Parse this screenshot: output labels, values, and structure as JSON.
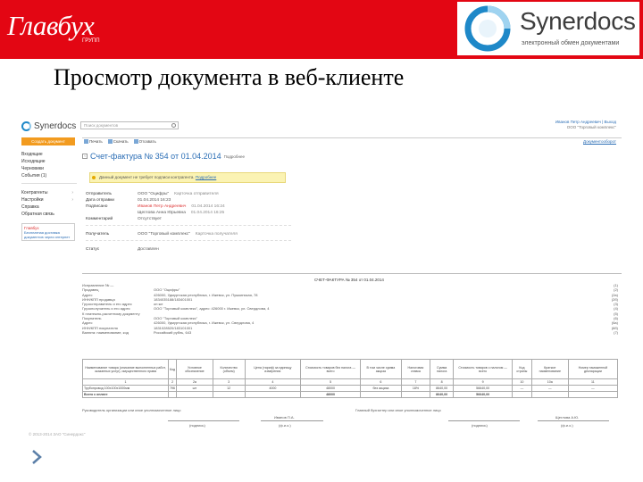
{
  "slide": {
    "left_logo": "Главбух",
    "left_logo_sub": "ГРУПП",
    "right_logo_name": "Synerdocs",
    "right_logo_tagline": "электронный обмен документами",
    "title": "Просмотр документа в веб-клиенте",
    "colors": {
      "header_red": "#e30613",
      "brand_blue": "#1e88c8"
    }
  },
  "app": {
    "logo": "Synerdocs",
    "search_placeholder": "Поиск документов",
    "user_name": "Иванов Петр Андреевич",
    "user_exit": "Выход",
    "user_org": "ООО \"Торговый комплекс\"",
    "new_doc_button": "Создать документ",
    "sidebar": [
      {
        "label": "Входящие",
        "arrow": ""
      },
      {
        "label": "Исходящие",
        "arrow": ""
      },
      {
        "label": "Черновики",
        "arrow": ""
      },
      {
        "label": "События (1)",
        "arrow": ""
      }
    ],
    "sidebar2": [
      {
        "label": "Контрагенты",
        "arrow": "›"
      },
      {
        "label": "Настройки",
        "arrow": "›"
      },
      {
        "label": "Справка",
        "arrow": ""
      },
      {
        "label": "Обратная связь",
        "arrow": ""
      }
    ],
    "promo_head": "Главбух",
    "promo_text": "Бесплатная доставка документов через интернет",
    "toolbar": [
      "Печать",
      "Скачать",
      "Отозвать"
    ],
    "help": "Документооборот",
    "doc_title": "Счет-фактура № 354 от 01.04.2014",
    "doc_more": "Подробнее",
    "notice_text": "Данный документ не требует подписи контрагента.",
    "notice_link": "Подробнее",
    "meta_sender": [
      {
        "k": "Отправитель",
        "v": "ООО \"Оцифры\"",
        "v2": "Карточка отправителя",
        "red": false
      },
      {
        "k": "Дата отправки",
        "v": "01.04.2014 16:23",
        "v2": "",
        "red": false
      },
      {
        "k": "Подписано",
        "v": "Иванов Петр Андреевич",
        "v2": "01.04.2014 16:24",
        "red": true
      },
      {
        "k": "",
        "v": "Щеглова Анна Юрьевна",
        "v2": "01.04.2014 16:25",
        "red": false
      },
      {
        "k": "Комментарий",
        "v": "Отсутствует",
        "v2": "",
        "red": false
      }
    ],
    "meta_receiver": [
      {
        "k": "Получатель",
        "v": "ООО \"Торговый комплекс\"",
        "v2": "Карточка получателя",
        "red": false
      }
    ],
    "meta_status": [
      {
        "k": "Статус",
        "v": "Доставлен",
        "v2": "",
        "red": false
      }
    ],
    "invoice_header": "СЧЕТ-ФАКТУРА № 354 от 01.04.2014",
    "invoice_fields": [
      {
        "k": "Исправление № —",
        "v": ""
      },
      {
        "k": "Продавец",
        "v": "ООО \"Оцифры\""
      },
      {
        "k": "Адрес",
        "v": "426000, Удмуртская республика, г. Ижевск, ул. Пушкинская, 78"
      },
      {
        "k": "ИНН/КПП продавца",
        "v": "1834035188/183401001"
      },
      {
        "k": "Грузоотправитель и его адрес",
        "v": "он же"
      },
      {
        "k": "Грузополучатель и его адрес",
        "v": "ООО \"Торговый комплекс\", адрес: 426000 г. Ижевск, ул. Свердлова, 4"
      },
      {
        "k": "К платежно-расчетному документу",
        "v": ""
      },
      {
        "k": "Покупатель",
        "v": "ООО \"Торговый комплекс\""
      },
      {
        "k": "Адрес",
        "v": "426000, Удмуртская республика, г. Ижевск, ул. Свердлова, 4"
      },
      {
        "k": "ИНН/КПП покупателя",
        "v": "1831028520/183101001"
      },
      {
        "k": "Валюта: наименование, код",
        "v": "Российский рубль, 643"
      }
    ],
    "invoice_side": [
      "(1)",
      "(2)",
      "(2а)",
      "(2б)",
      "(3)",
      "(4)",
      "(5)",
      "(6)",
      "(6а)",
      "(6б)",
      "(7)"
    ],
    "table_headers": [
      "Наименование товара (описание выполненных работ, оказанных услуг), имущественного права",
      "Код",
      "Условное обозначение",
      "Количество (объем)",
      "Цена (тариф) за единицу измерения",
      "Стоимость товаров без налога — всего",
      "В том числе сумма акциза",
      "Налоговая ставка",
      "Сумма налога",
      "Стоимость товаров с налогом — всего",
      "Код страны",
      "Краткое наименование",
      "Номер таможенной декларации"
    ],
    "table_nums": [
      "1",
      "2",
      "2а",
      "3",
      "4",
      "5",
      "6",
      "7",
      "8",
      "9",
      "10",
      "10а",
      "11"
    ],
    "table_row": [
      "Трубопровод 100х100х1000мм",
      "796",
      "шт",
      "12",
      "4000",
      "48000",
      "без акциза",
      "18%",
      "8640,00",
      "56640,00",
      "—",
      "—",
      "—"
    ],
    "table_total": [
      "Всего к оплате",
      "",
      "",
      "",
      "",
      "48000",
      "",
      "",
      "8640,00",
      "56640,00",
      "",
      "",
      ""
    ],
    "signs": {
      "chief": "Руководитель организации или иное уполномоченное лицо",
      "chief_name": "Иванов П.А.",
      "accountant": "Главный бухгалтер или иное уполномоченное лицо",
      "accountant_name": "Щеглова А.Ю.",
      "sign_caption": "(подпись)",
      "name_caption": "(ф.и.о.)"
    },
    "copyright": "© 2013-2014 ЗАО \"Синердокс\""
  }
}
